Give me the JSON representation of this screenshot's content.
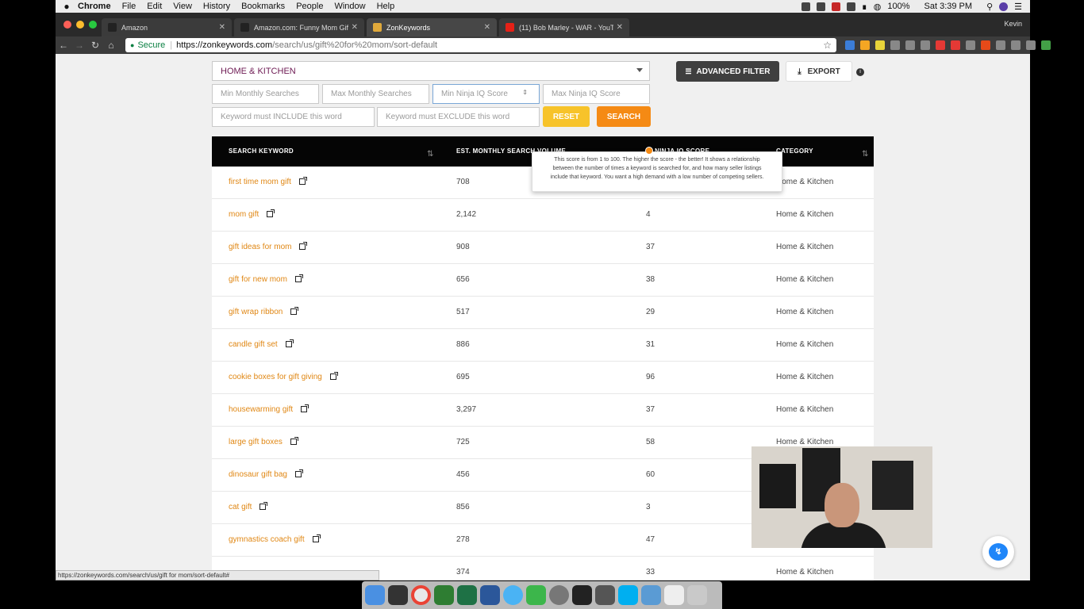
{
  "menubar": {
    "app": "Chrome",
    "items": [
      "File",
      "Edit",
      "View",
      "History",
      "Bookmarks",
      "People",
      "Window",
      "Help"
    ],
    "battery": "100%",
    "clock": "Sat 3:39 PM"
  },
  "tabs": [
    {
      "label": "Amazon",
      "icon": "amazon-icon",
      "color": "#222222"
    },
    {
      "label": "Amazon.com: Funny Mom Gift",
      "icon": "amazon-icon",
      "color": "#222222"
    },
    {
      "label": "ZonKeywords",
      "icon": "zonkeywords-icon",
      "color": "#e0a93b"
    },
    {
      "label": "(11) Bob Marley - WAR - YouTu",
      "icon": "youtube-icon",
      "color": "#e62117"
    }
  ],
  "profile": "Kevin",
  "omnibox": {
    "secure": "Secure",
    "host": "https://zonkeywords.com",
    "path": "/search/us/gift%20for%20mom/sort-default"
  },
  "filters": {
    "category": "HOME & KITCHEN",
    "min_monthly": "Min Monthly Searches",
    "max_monthly": "Max Monthly Searches",
    "min_iq": "Min Ninja IQ Score",
    "max_iq": "Max Ninja IQ Score",
    "include": "Keyword must INCLUDE this word",
    "exclude": "Keyword must EXCLUDE this word",
    "reset": "RESET",
    "search": "SEARCH",
    "advanced": "ADVANCED FILTER",
    "export": "EXPORT",
    "info": "i"
  },
  "table": {
    "headers": {
      "keyword": "SEARCH KEYWORD",
      "volume": "EST. MONTHLY SEARCH VOLUME",
      "score": "NINJA IQ SCORE",
      "category": "CATEGORY"
    },
    "rows": [
      {
        "keyword": "first time mom gift",
        "volume": "708",
        "score": "",
        "category": "Home & Kitchen"
      },
      {
        "keyword": "mom gift",
        "volume": "2,142",
        "score": "4",
        "category": "Home & Kitchen"
      },
      {
        "keyword": "gift ideas for mom",
        "volume": "908",
        "score": "37",
        "category": "Home & Kitchen"
      },
      {
        "keyword": "gift for new mom",
        "volume": "656",
        "score": "38",
        "category": "Home & Kitchen"
      },
      {
        "keyword": "gift wrap ribbon",
        "volume": "517",
        "score": "29",
        "category": "Home & Kitchen"
      },
      {
        "keyword": "candle gift set",
        "volume": "886",
        "score": "31",
        "category": "Home & Kitchen"
      },
      {
        "keyword": "cookie boxes for gift giving",
        "volume": "695",
        "score": "96",
        "category": "Home & Kitchen"
      },
      {
        "keyword": "housewarming gift",
        "volume": "3,297",
        "score": "37",
        "category": "Home & Kitchen"
      },
      {
        "keyword": "large gift boxes",
        "volume": "725",
        "score": "58",
        "category": "Home & Kitchen"
      },
      {
        "keyword": "dinosaur gift bag",
        "volume": "456",
        "score": "60",
        "category": ""
      },
      {
        "keyword": "cat gift",
        "volume": "856",
        "score": "3",
        "category": ""
      },
      {
        "keyword": "gymnastics coach gift",
        "volume": "278",
        "score": "47",
        "category": ""
      },
      {
        "keyword": "",
        "volume": "374",
        "score": "33",
        "category": "Home & Kitchen"
      }
    ]
  },
  "tooltip": "This score is from 1 to 100. The higher the score - the better! It shows a relationship between the number of times a keyword is searched for, and how many seller listings include that keyword. You want a high demand with a low number of competing sellers.",
  "status_url": "https://zonkeywords.com/search/us/gift for mom/sort-default#",
  "accent": "#e08714"
}
